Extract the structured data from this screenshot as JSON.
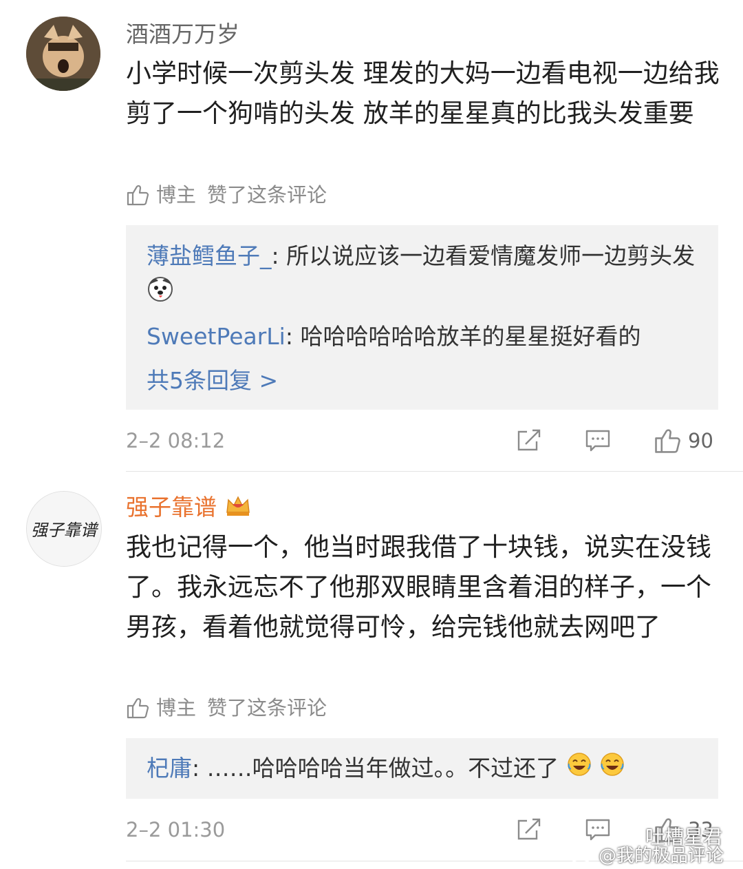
{
  "comments": [
    {
      "username": "酒酒万万岁",
      "text": "小学时候一次剪头发 理发的大妈一边看电视一边给我剪了一个狗啃的头发 放羊的星星真的比我头发重要",
      "liked_by": "博主",
      "liked_text": "赞了这条评论",
      "replies": [
        {
          "user": "薄盐鳕鱼子_",
          "text": "所以说应该一边看爱情魔发师一边剪头发",
          "emoji": "dog-face-icon"
        },
        {
          "user": "SweetPearLi",
          "text": "哈哈哈哈哈哈放羊的星星挺好看的"
        }
      ],
      "more_replies": "共5条回复 >",
      "time": "2–2 08:12",
      "like_count": "90"
    },
    {
      "username": "强子靠谱",
      "avatar_text": "强子靠谱",
      "username_color": "#e9722e",
      "badge": "crown-badge-icon",
      "text": "我也记得一个，他当时跟我借了十块钱，说实在没钱了。我永远忘不了他那双眼睛里含着泪的样子，一个男孩，看着他就觉得可怜，给完钱他就去网吧了",
      "liked_by": "博主",
      "liked_text": "赞了这条评论",
      "replies": [
        {
          "user": "杞庸",
          "text": "……哈哈哈哈当年做过。。不过还了",
          "emoji": "laugh-cry-icon"
        }
      ],
      "time": "2–2 01:30",
      "like_count": "33"
    }
  ],
  "watermarks": {
    "wechat": "吐槽星君",
    "weibo": "@我的极品评论"
  },
  "colors": {
    "link": "#4e7ab8",
    "vip_name": "#e9722e",
    "meta": "#8b8b8b",
    "reply_bg": "#f2f2f2"
  }
}
